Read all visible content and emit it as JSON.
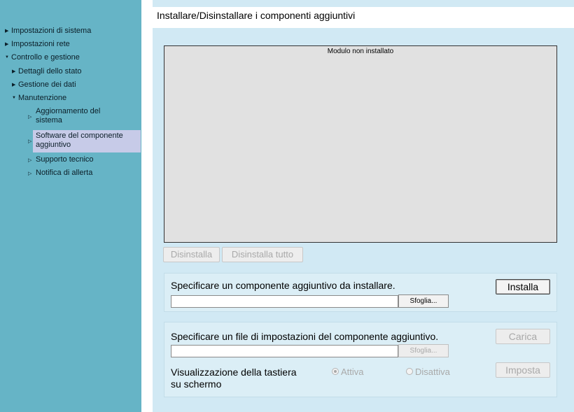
{
  "sidebar": {
    "items": [
      {
        "label": "Impostazioni di sistema"
      },
      {
        "label": "Impostazioni rete"
      },
      {
        "label": "Controllo e gestione"
      },
      {
        "label": "Dettagli dello stato"
      },
      {
        "label": "Gestione dei dati"
      },
      {
        "label": "Manutenzione"
      },
      {
        "label_line1": "Aggiornamento del",
        "label_line2": "sistema"
      },
      {
        "label_line1": "Software del componente",
        "label_line2": "aggiuntivo"
      },
      {
        "label": "Supporto tecnico"
      },
      {
        "label": "Notifica di allerta"
      }
    ]
  },
  "main": {
    "title": "Installare/Disinstallare i componenti aggiuntivi",
    "module_status": "Modulo non installato",
    "uninstall_label": "Disinstalla",
    "uninstall_all_label": "Disinstalla tutto",
    "install_panel": {
      "instruction": "Specificare un componente aggiuntivo da installare.",
      "file_value": "",
      "browse_label": "Sfoglia...",
      "install_label": "Installa"
    },
    "settings_panel": {
      "instruction": "Specificare un file di impostazioni del componente aggiuntivo.",
      "file_value": "",
      "browse_label": "Sfoglia...",
      "load_label": "Carica",
      "keyboard_label_line1": "Visualizzazione della tastiera",
      "keyboard_label_line2": "su schermo",
      "radio_on_label": "Attiva",
      "radio_off_label": "Disattiva",
      "radio_selected": "Attiva",
      "set_label": "Imposta"
    }
  },
  "colors": {
    "sidebar_bg": "#66b4c6",
    "main_bg": "#d1e9f4",
    "selected_item_bg": "#c7cbe8",
    "disabled_text": "#a9a9a9"
  }
}
